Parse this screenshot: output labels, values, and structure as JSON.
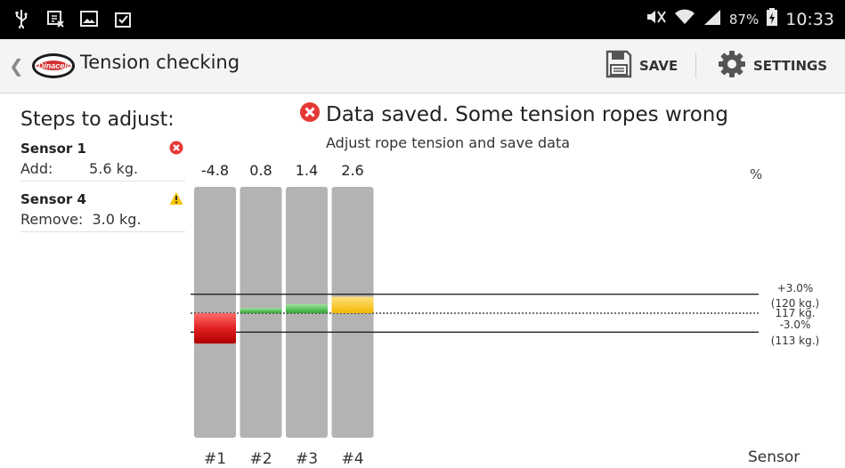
{
  "status_bar": {
    "battery": "87%",
    "time": "10:33",
    "icons": [
      "usb-icon",
      "screenshot-icon",
      "gallery-icon",
      "clipboard-check-icon",
      "mute-icon",
      "wifi-icon",
      "signal-icon",
      "battery-charging-icon"
    ]
  },
  "action_bar": {
    "title": "Tension checking",
    "logo_text": "Dinacell",
    "save_label": "SAVE",
    "settings_label": "SETTINGS"
  },
  "steps": {
    "title": "Steps to adjust:",
    "sensors": [
      {
        "name": "Sensor 1",
        "status": "error",
        "detail": "Add:        5.6 kg."
      },
      {
        "name": "Sensor 4",
        "status": "warning",
        "detail": "Remove:  3.0 kg."
      }
    ]
  },
  "message": {
    "title": "Data saved. Some tension ropes wrong",
    "subtitle": "Adjust rope tension and save data"
  },
  "chart_data": {
    "type": "bar",
    "categories": [
      "#1",
      "#2",
      "#3",
      "#4"
    ],
    "values": [
      -4.8,
      0.8,
      1.4,
      2.6
    ],
    "value_labels": [
      "-4.8",
      "0.8",
      "1.4",
      "2.6"
    ],
    "bar_colors": [
      "#e02020",
      "#33bb33",
      "#33bb33",
      "#f5c400"
    ],
    "unit_label": "%",
    "x_axis_label": "Sensor",
    "reference_lines": [
      {
        "label": "+3.0%",
        "sublabel": "(120 kg.)",
        "value": 3.0,
        "style": "solid"
      },
      {
        "label": "117 kg.",
        "value": 0,
        "style": "dotted"
      },
      {
        "label": "-3.0%",
        "sublabel": "(113 kg.)",
        "value": -3.0,
        "style": "solid"
      }
    ],
    "ylim": [
      -20,
      20
    ]
  },
  "colors": {
    "error": "#e53935",
    "warning": "#f5c400",
    "track": "#b3b3b3",
    "status_bar": "#000000",
    "action_bar": "#f4f4f4"
  }
}
